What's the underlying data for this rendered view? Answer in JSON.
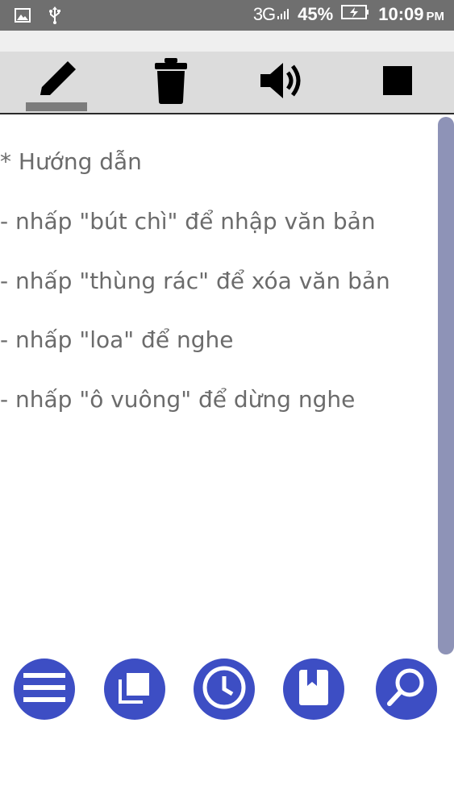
{
  "status_bar": {
    "network": "3G",
    "battery": "45%",
    "time": "10:09",
    "ampm": "PM",
    "icons": [
      "image-icon",
      "usb-icon",
      "signal-icon",
      "battery-charging-icon"
    ]
  },
  "toolbar": {
    "tools": [
      {
        "name": "pencil-icon",
        "active": true
      },
      {
        "name": "trash-icon",
        "active": false
      },
      {
        "name": "speaker-icon",
        "active": false
      },
      {
        "name": "stop-icon",
        "active": false
      }
    ]
  },
  "instructions": {
    "title": "* Hướng dẫn",
    "lines": [
      "- nhấp \"bút chì\" để nhập văn bản",
      "- nhấp \"thùng rác\" để xóa văn bản",
      "- nhấp \"loa\" để nghe",
      "- nhấp \"ô vuông\" để dừng nghe"
    ]
  },
  "bottom_nav": {
    "buttons": [
      "menu-icon",
      "copy-icon",
      "clock-icon",
      "bookmark-icon",
      "search-icon"
    ]
  },
  "colors": {
    "accent": "#3d4ec4",
    "status_bar": "#6f6f6f",
    "toolbar": "#dcdcdc",
    "text": "#6b6b6b",
    "scrollbar": "#8e93b7"
  }
}
